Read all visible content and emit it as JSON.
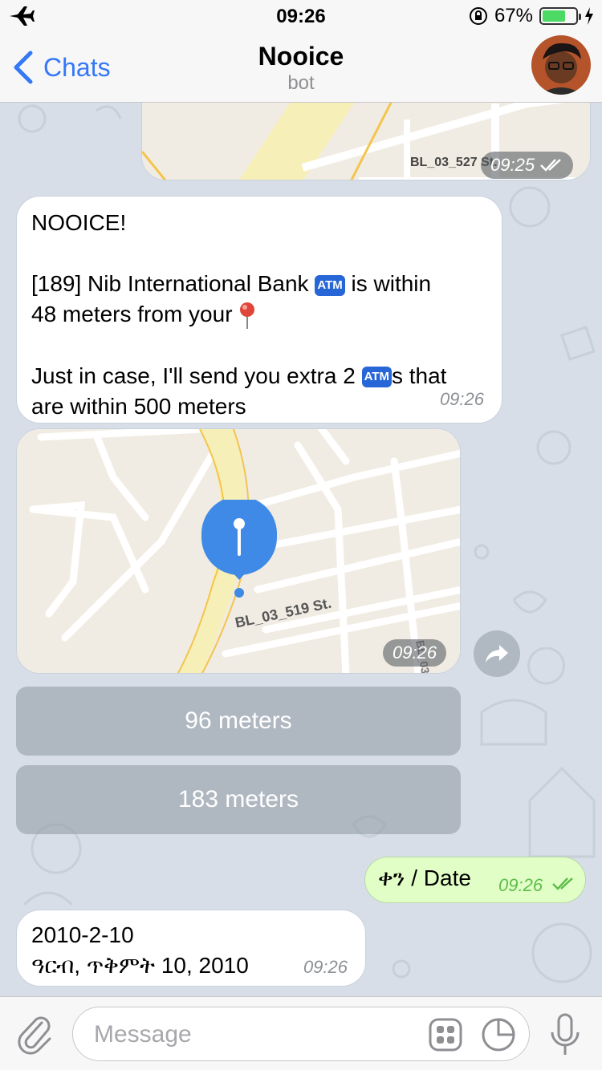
{
  "status_bar": {
    "time": "09:26",
    "battery_percent": "67%",
    "battery_level": 0.67
  },
  "nav": {
    "back_label": "Chats",
    "title": "Nooice",
    "subtitle": "bot"
  },
  "messages": {
    "map1": {
      "street_label": "BL_03_527 St.",
      "time": "09:25"
    },
    "text1": {
      "line1": "NOOICE!",
      "line2_a": "[189] Nib International Bank ",
      "line2_b": " is within",
      "line3": "48 meters from your ",
      "line4_a": "Just in case, I'll send you extra 2 ",
      "line4_b": "s that",
      "line5": "are within 500 meters",
      "time": "09:26",
      "atm_glyph": "ATM"
    },
    "map2": {
      "street_label": "BL_03_519 St.",
      "side_label": "BL_03_",
      "time": "09:26"
    },
    "buttons": [
      "96 meters",
      "183 meters"
    ],
    "outgoing": {
      "text": "ቀን / Date",
      "time": "09:26"
    },
    "date_reply": {
      "line1": "2010-2-10",
      "line2": "ዓርብ, ጥቅምት 10, 2010",
      "time": "09:26"
    }
  },
  "input": {
    "placeholder": "Message"
  },
  "colors": {
    "accent": "#3478f6",
    "outgoing_bubble": "#e1fec6",
    "read_check": "#5ebd4b",
    "pin": "#3e8ae6"
  }
}
